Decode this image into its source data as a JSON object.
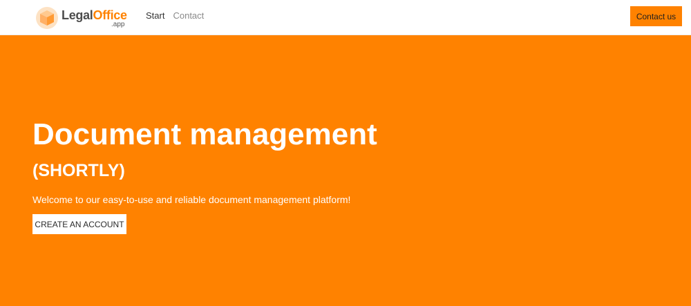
{
  "navbar": {
    "brand": {
      "part1": "Legal",
      "part2": "Office",
      "suffix": ".app"
    },
    "links": [
      {
        "label": "Start"
      },
      {
        "label": "Contact"
      }
    ],
    "contact_button": "Contact us"
  },
  "hero": {
    "title": "Document management",
    "subtitle": "(SHORTLY)",
    "welcome": "Welcome to our easy-to-use and reliable document management platform!",
    "cta_label": "CREATE AN ACCOUNT"
  },
  "colors": {
    "accent": "#ff8200",
    "navbar_bg": "#ffffff",
    "text_dark": "#333333",
    "text_muted": "#8a8a8a"
  },
  "icons": {
    "logo": "cube-logo-icon"
  }
}
